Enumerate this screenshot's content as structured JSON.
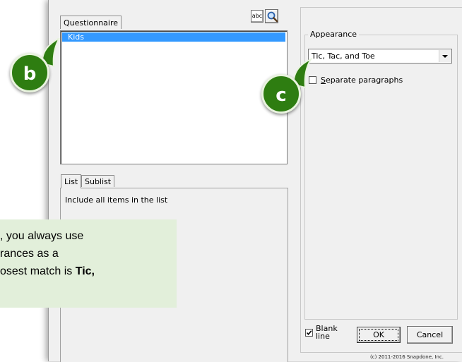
{
  "questionnaire": {
    "tab_label": "Questionnaire",
    "selected_item": "Kids"
  },
  "toolbar": {
    "abc_label": "abc",
    "search_icon": "magnifier-icon"
  },
  "list_tabs": [
    {
      "label": "List"
    },
    {
      "label": "Sublist"
    }
  ],
  "list_description": "Include all items in the list",
  "appearance": {
    "group_label": "Appearance",
    "selected_option": "Tic, Tac, and Toe",
    "separate_paragraphs_label": "Separate paragraphs",
    "separate_paragraphs_checked": false
  },
  "bottom": {
    "blank_line_label_1": "Blank",
    "blank_line_label_2": "line",
    "blank_line_checked": true,
    "ok_label": "OK",
    "cancel_label": "Cancel",
    "copyright": "(c) 2011-2016 Snapdone, Inc."
  },
  "tooltip": {
    "line1": ", you always use",
    "line2": "rances as a",
    "line3_pre": "osest match is ",
    "line3_bold": "Tic,"
  },
  "callouts": {
    "b": "b",
    "c": "c"
  },
  "colors": {
    "selection": "#3399ff",
    "callout_green": "#2e7d11",
    "tooltip_bg": "#e2efda"
  }
}
